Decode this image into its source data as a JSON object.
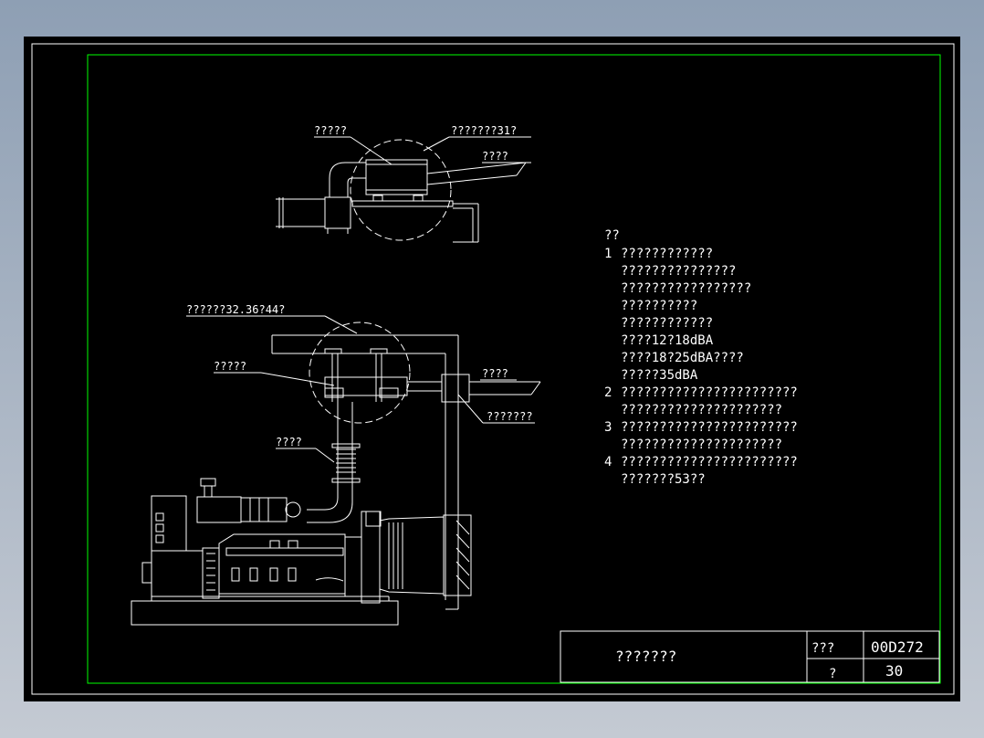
{
  "labels": {
    "top_left": "?????",
    "top_right": "???????31?",
    "top_pipe": "????",
    "main_top": "??????32.36?44?",
    "main_left": "?????",
    "main_right": "????",
    "main_box": "???????",
    "main_bellows": "????"
  },
  "notes": {
    "heading": "??",
    "lines": [
      {
        "num": "1",
        "text": "????????????"
      },
      {
        "num": "",
        "text": "???????????????"
      },
      {
        "num": "",
        "text": "?????????????????"
      },
      {
        "num": "",
        "text": "??????????"
      },
      {
        "num": "",
        "text": "????????????"
      },
      {
        "num": "",
        "text": "????12?18dBA"
      },
      {
        "num": "",
        "text": "????18?25dBA????"
      },
      {
        "num": "",
        "text": "?????35dBA"
      },
      {
        "num": "2",
        "text": "???????????????????????"
      },
      {
        "num": "",
        "text": "?????????????????????"
      },
      {
        "num": "3",
        "text": "???????????????????????"
      },
      {
        "num": "",
        "text": "?????????????????????"
      },
      {
        "num": "4",
        "text": "???????????????????????"
      },
      {
        "num": "",
        "text": "???????53??"
      }
    ]
  },
  "title_block": {
    "title": "???????",
    "label_a": "???",
    "value_a": "00D272",
    "label_b": "?",
    "value_b": "30"
  },
  "colors": {
    "background": "#000000",
    "line": "#ffffff",
    "frame": "#00ff00"
  }
}
